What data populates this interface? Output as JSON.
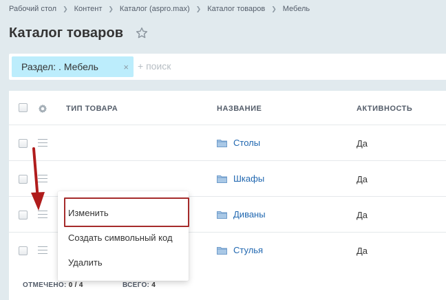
{
  "breadcrumbs": [
    "Рабочий стол",
    "Контент",
    "Каталог (aspro.max)",
    "Каталог товаров",
    "Мебель"
  ],
  "page": {
    "title": "Каталог товаров"
  },
  "filter": {
    "tag_label": "Раздел: . Мебель",
    "tag_close": "×",
    "search_placeholder": "+ поиск"
  },
  "grid": {
    "columns": {
      "type": "ТИП ТОВАРА",
      "name": "НАЗВАНИЕ",
      "active": "АКТИВНОСТЬ"
    },
    "rows": [
      {
        "type": "",
        "name": "Столы",
        "active": "Да"
      },
      {
        "type": "",
        "name": "Шкафы",
        "active": "Да"
      },
      {
        "type": "",
        "name": "Диваны",
        "active": "Да"
      },
      {
        "type": "",
        "name": "Стулья",
        "active": "Да"
      }
    ],
    "footer": {
      "marked_label": "ОТМЕЧЕНО:",
      "marked_value": "0 / 4",
      "total_label": "ВСЕГО:",
      "total_value": "4"
    }
  },
  "context_menu": {
    "items": [
      "Изменить",
      "Создать символьный код",
      "Удалить"
    ]
  },
  "colors": {
    "background": "#e1eaee",
    "link": "#2067b0",
    "filter_tag": "#bcedfc",
    "highlight": "#a52a2a"
  },
  "icons": [
    "star-icon",
    "gear-icon",
    "burger-icon",
    "folder-icon",
    "close-icon"
  ]
}
